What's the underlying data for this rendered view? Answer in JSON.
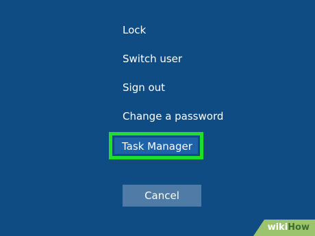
{
  "menu": {
    "items": [
      {
        "label": "Lock"
      },
      {
        "label": "Switch user"
      },
      {
        "label": "Sign out"
      },
      {
        "label": "Change a password"
      }
    ],
    "task_manager": {
      "label": "Task Manager",
      "highlight_color": "#1ee02b",
      "selected_bg": "#1e63a7"
    }
  },
  "actions": {
    "cancel_label": "Cancel"
  },
  "watermark": {
    "wiki": "wiki",
    "how": "How"
  },
  "theme": {
    "background": "#0f4c84",
    "button_bg": "#4f7ba6",
    "text_color": "#ffffff"
  }
}
